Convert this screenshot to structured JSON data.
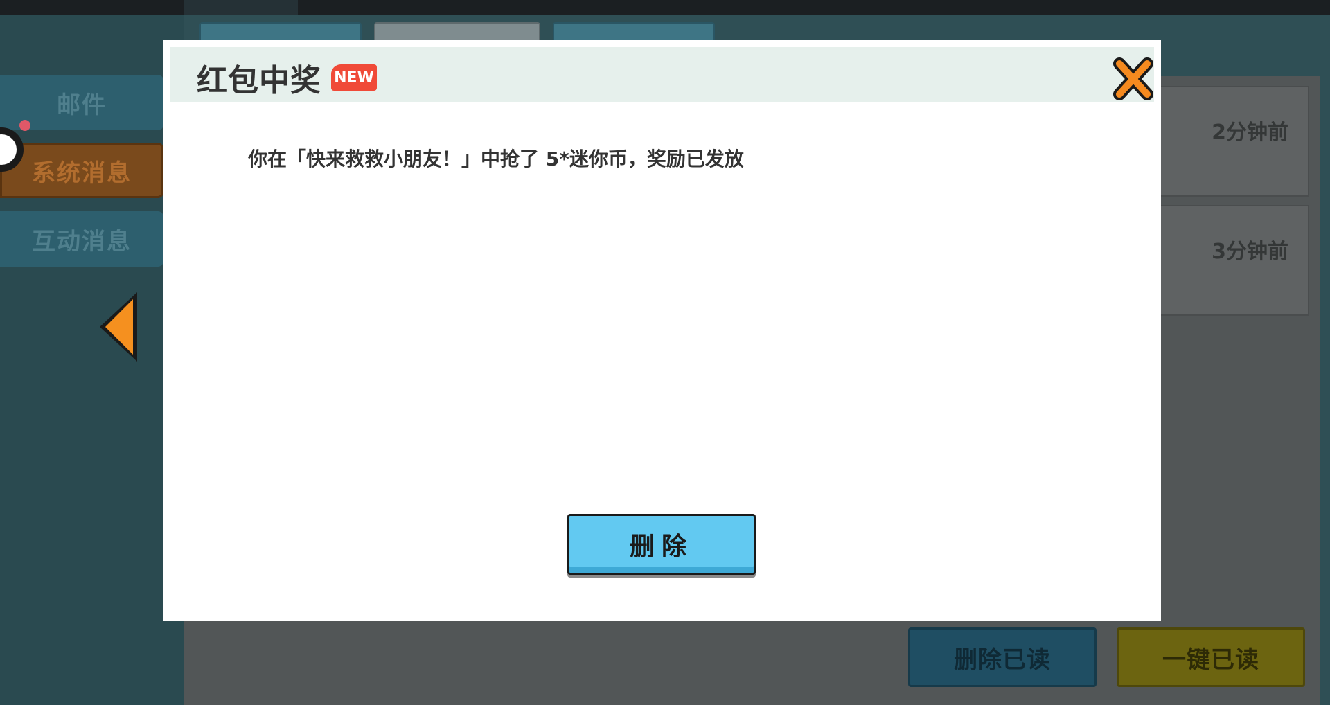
{
  "sidebar": {
    "items": [
      {
        "label": "邮件"
      },
      {
        "label": "系统消息"
      },
      {
        "label": "互动消息"
      }
    ]
  },
  "messages": [
    {
      "time": "2分钟前"
    },
    {
      "time": "3分钟前"
    }
  ],
  "footer": {
    "delete_read_label": "删除已读",
    "mark_all_read_label": "一键已读"
  },
  "modal": {
    "title": "红包中奖",
    "badge": "NEW",
    "message": "你在「快来救救小朋友！」中抢了 5*迷你币，奖励已发放",
    "delete_label": "删除"
  },
  "colors": {
    "accent_orange": "#f58a1f",
    "delete_button": "#62c9f1",
    "badge_red": "#f04a38"
  }
}
